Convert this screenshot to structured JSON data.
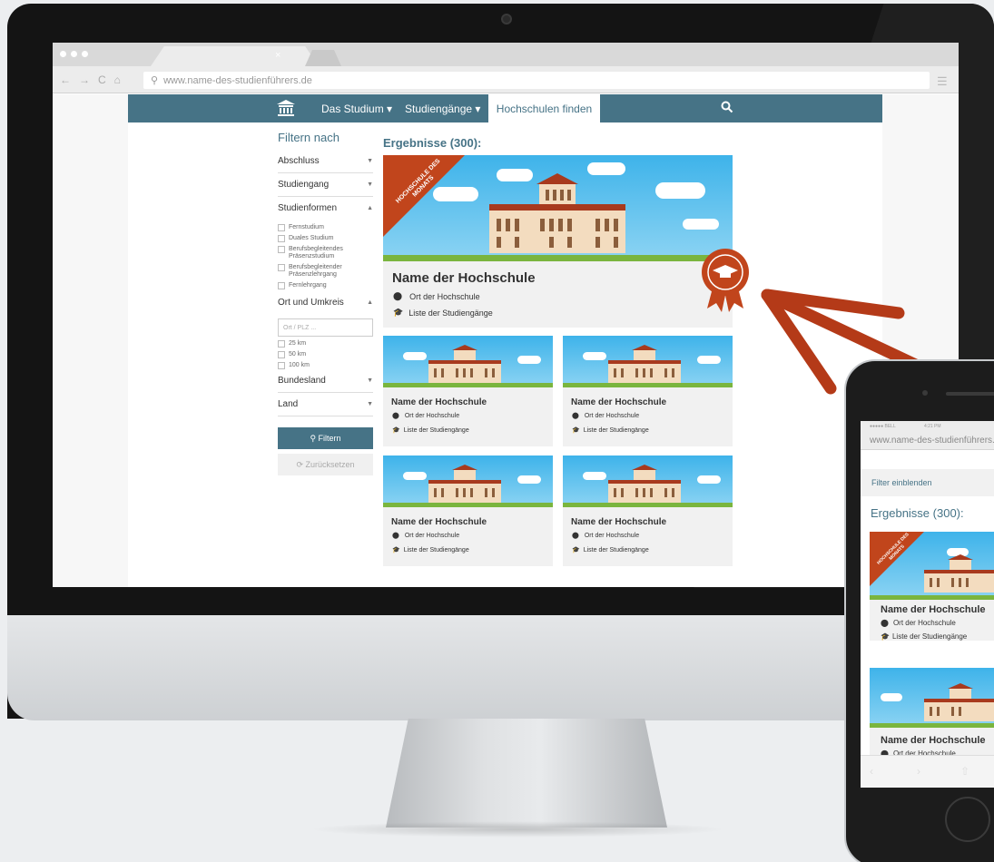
{
  "browser": {
    "url": "www.name-des-studienführers.de",
    "tab_close": "×"
  },
  "nav": {
    "items": [
      "Das Studium ▾",
      "Studiengänge ▾"
    ],
    "active": "Hochschulen finden"
  },
  "filter": {
    "title": "Filtern nach",
    "selects": {
      "abschluss": "Abschluss",
      "studiengang": "Studiengang",
      "studienformen": "Studienformen",
      "ort": "Ort und Umkreis",
      "bundesland": "Bundesland",
      "land": "Land"
    },
    "studienformen_options": [
      "Fernstudium",
      "Duales Studium",
      "Berufsbegleitendes Präsenzstudium",
      "Berufsbegleitender Präsenzlehrgang",
      "Fernlehrgang"
    ],
    "ort_placeholder": "Ort / PLZ ...",
    "radius_options": [
      "25 km",
      "50 km",
      "100 km"
    ],
    "filter_button": "Filtern",
    "reset_button": "Zurücksetzen"
  },
  "results": {
    "title": "Ergebnisse (300):",
    "featured_badge": "HOCHSCHULE DES MONATS",
    "card_name": "Name der Hochschule",
    "card_location": "Ort der Hochschule",
    "card_programs": "Liste der Studiengänge"
  },
  "phone": {
    "status_left": "●●●●● BELL ",
    "status_time": "4:21 PM",
    "url": "www.name-des-studienführers.de",
    "filter_toggle": "Filter einblenden",
    "results_title": "Ergebnisse (300):",
    "card_name": "Name der Hochschule",
    "card_location": "Ort der Hochschule",
    "card_programs": "Liste der Studiengänge"
  },
  "colors": {
    "brand": "#467386",
    "accent": "#c1451c",
    "sky": "#3eb3ea",
    "grass": "#7ab53e"
  },
  "icons": [
    "search-icon",
    "map-pin-icon",
    "graduation-cap-icon",
    "reset-icon",
    "award-ribbon-icon",
    "university-logo-icon"
  ]
}
